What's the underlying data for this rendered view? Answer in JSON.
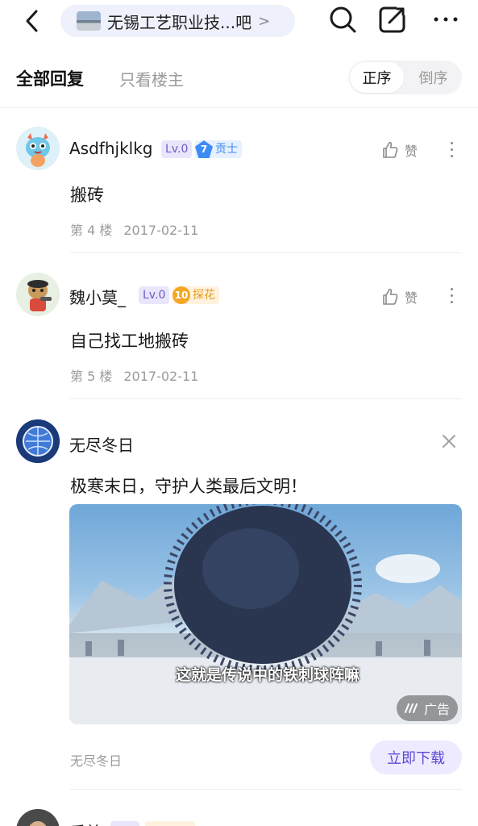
{
  "header": {
    "forum_name": "无锡工艺职业技...吧",
    "forum_arrow": ">"
  },
  "tabs": {
    "all_replies": "全部回复",
    "owner_only": "只看楼主",
    "sort_asc": "正序",
    "sort_desc": "倒序"
  },
  "posts": [
    {
      "username": "Asdfhjklkg",
      "level": "Lv.0",
      "badge_num": "7",
      "badge_text": "贡士",
      "badge_color": "#3d8cf5",
      "like_label": "赞",
      "content": "搬砖",
      "floor": "第 4 楼",
      "date": "2017-02-11"
    },
    {
      "username": "魏小莫_",
      "level": "Lv.0",
      "badge_num": "10",
      "badge_text": "探花",
      "badge_color": "#f5a623",
      "like_label": "赞",
      "content": "自己找工地搬砖",
      "floor": "第 5 楼",
      "date": "2017-02-11"
    }
  ],
  "ad": {
    "username": "无尽冬日",
    "content": "极寒末日，守护人类最后文明！",
    "video_caption": "这就是传说中的铁刺球阵嘛",
    "ad_label": "广告",
    "footer_name": "无尽冬日",
    "download_label": "立即下载"
  },
  "next_post": {
    "username": "乐美"
  },
  "colors": {
    "accent": "#5b4bd6",
    "pill_bg": "#eef0fb"
  }
}
